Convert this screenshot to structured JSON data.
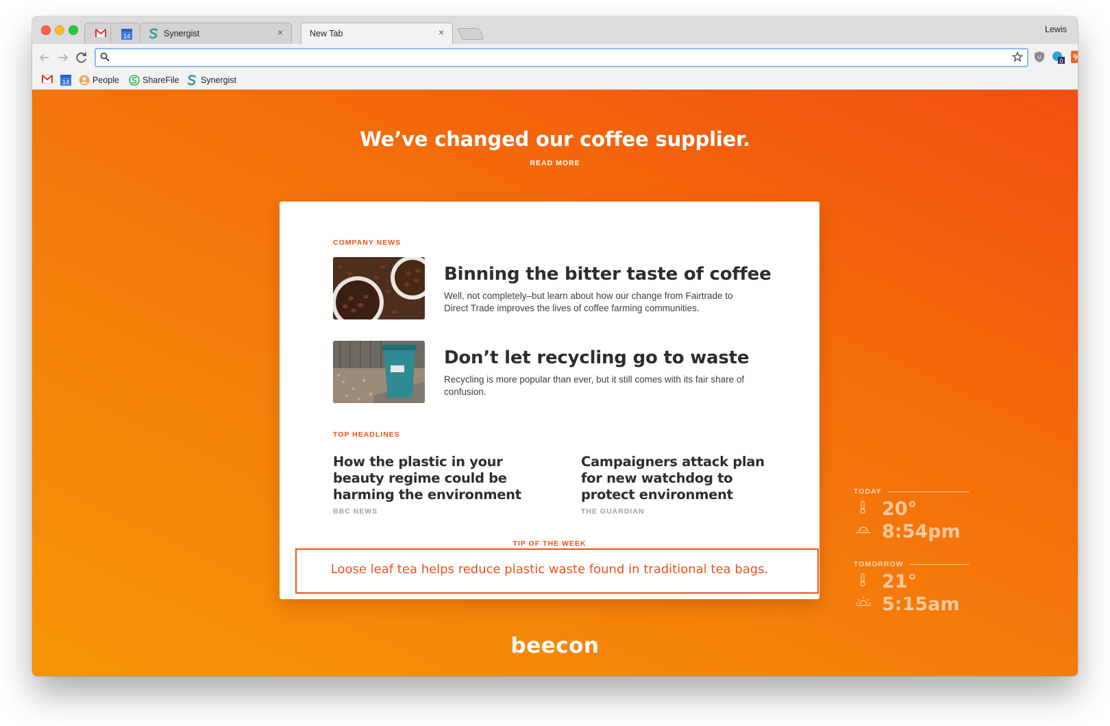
{
  "browser": {
    "tabs": [
      {
        "type": "pinned",
        "icon": "gmail-icon"
      },
      {
        "type": "pinned",
        "icon": "calendar-icon",
        "badge": "14"
      },
      {
        "type": "normal",
        "icon": "synergist-icon",
        "label": "Synergist"
      },
      {
        "type": "active",
        "label": "New Tab"
      }
    ],
    "close_glyph": "×",
    "profile_name": "Lewis",
    "address": {
      "value": "",
      "placeholder": ""
    },
    "bookmarks": [
      {
        "icon": "gmail-icon",
        "label": ""
      },
      {
        "icon": "calendar-icon",
        "label": "",
        "badge": "14"
      },
      {
        "icon": "people-icon",
        "label": "People"
      },
      {
        "icon": "sharefile-icon",
        "label": "ShareFile"
      },
      {
        "icon": "synergist-icon",
        "label": "Synergist"
      }
    ],
    "extension_badge": "0"
  },
  "page": {
    "hero_title": "We’ve changed our coffee supplier.",
    "hero_link": "READ MORE",
    "company_news_label": "COMPANY NEWS",
    "stories": [
      {
        "title": "Binning the bitter taste of coffee",
        "description": "Well, not completely–but learn about how our change from Fairtrade to Direct Trade improves the lives of coffee farming communities.",
        "image": "coffee-beans-thumbnail"
      },
      {
        "title": "Don’t let recycling go to waste",
        "description": "Recycling is more popular than ever, but it still comes with its fair share of confusion.",
        "image": "recycling-bin-thumbnail"
      }
    ],
    "top_headlines_label": "TOP HEADLINES",
    "headlines": [
      {
        "title": "How the plastic in your beauty regime could be harming the environment",
        "source": "BBC NEWS"
      },
      {
        "title": "Campaigners attack plan for new watchdog to protect environment",
        "source": "THE GUARDIAN"
      }
    ],
    "tip_label": "TIP OF THE WEEK",
    "tip_text": "Loose leaf tea helps reduce plastic waste found in traditional tea bags.",
    "brand": "beecon"
  },
  "weather": {
    "today": {
      "label": "TODAY",
      "temperature": "20°",
      "sun_time": "8:54pm",
      "sun_icon": "sunset-icon"
    },
    "tomorrow": {
      "label": "TOMORROW",
      "temperature": "21°",
      "sun_time": "5:15am",
      "sun_icon": "sunrise-icon"
    }
  },
  "colors": {
    "accent": "#f0501a",
    "gradient_top": "#f24f12",
    "gradient_bottom": "#f69406",
    "headline_text": "#2d2d2d",
    "source_text": "#a0a0a0"
  }
}
